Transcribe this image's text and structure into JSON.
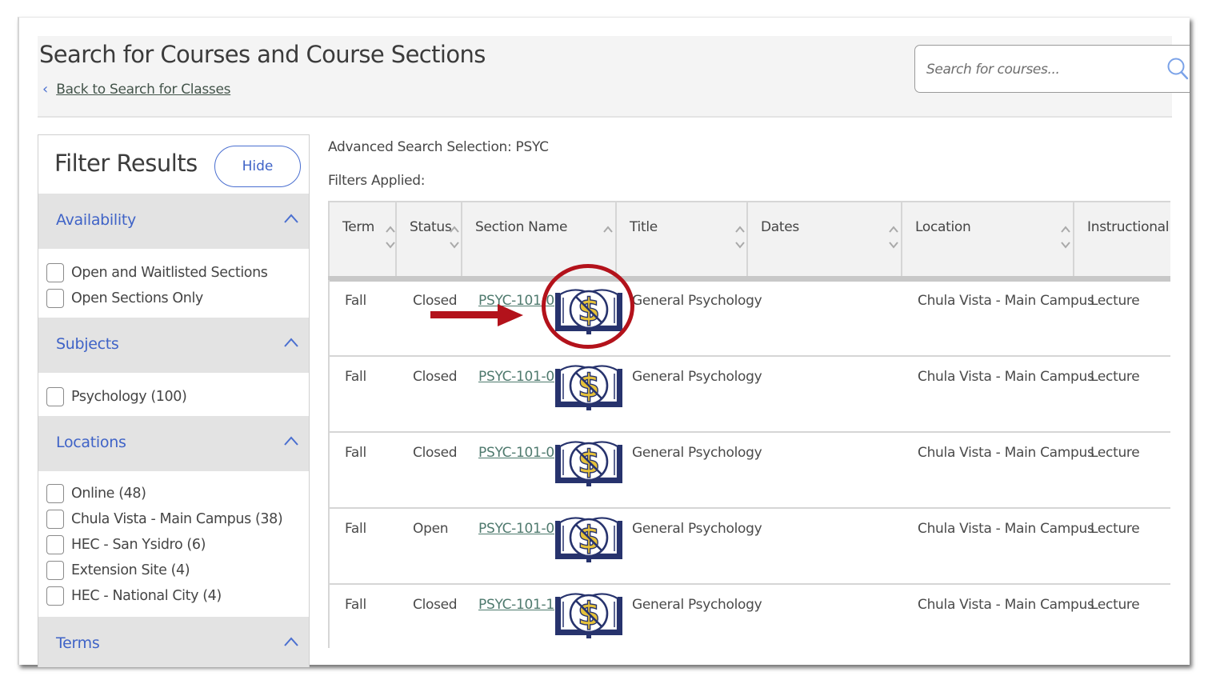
{
  "header": {
    "title": "Search for Courses and Course Sections",
    "back_link": "Back to Search for Classes",
    "search_placeholder": "Search for courses..."
  },
  "filters": {
    "title": "Filter Results",
    "hide_label": "Hide",
    "sections": [
      {
        "label": "Availability",
        "options": [
          "Open and Waitlisted Sections",
          "Open Sections Only"
        ]
      },
      {
        "label": "Subjects",
        "options": [
          "Psychology (100)"
        ]
      },
      {
        "label": "Locations",
        "options": [
          "Online (48)",
          "Chula Vista - Main Campus (38)",
          "HEC - San Ysidro (6)",
          "Extension Site (4)",
          "HEC - National City (4)"
        ]
      },
      {
        "label": "Terms",
        "options": []
      }
    ]
  },
  "main": {
    "advanced_search": "Advanced Search Selection: PSYC",
    "filters_applied": "Filters Applied:"
  },
  "table": {
    "columns": [
      "Term",
      "Status",
      "Section Name",
      "Title",
      "Dates",
      "Location",
      "Instructional M"
    ],
    "rows": [
      {
        "term": "Fall",
        "status": "Closed",
        "section": "PSYC-101-01",
        "title": "General Psychology",
        "dates": "",
        "location": "Chula Vista - Main Campus",
        "method": "Lecture",
        "icon": "zero-textbook-cost-icon"
      },
      {
        "term": "Fall",
        "status": "Closed",
        "section": "PSYC-101-02",
        "title": "General Psychology",
        "dates": "",
        "location": "Chula Vista - Main Campus",
        "method": "Lecture",
        "icon": "zero-textbook-cost-icon"
      },
      {
        "term": "Fall",
        "status": "Closed",
        "section": "PSYC-101-03",
        "title": "General Psychology",
        "dates": "",
        "location": "Chula Vista - Main Campus",
        "method": "Lecture",
        "icon": "zero-textbook-cost-icon"
      },
      {
        "term": "Fall",
        "status": "Open",
        "section": "PSYC-101-04",
        "title": "General Psychology",
        "dates": "",
        "location": "Chula Vista - Main Campus",
        "method": "Lecture",
        "icon": "zero-textbook-cost-icon"
      },
      {
        "term": "Fall",
        "status": "Closed",
        "section": "PSYC-101-15",
        "title": "General Psychology",
        "dates": "",
        "location": "Chula Vista - Main Campus",
        "method": "Lecture",
        "icon": "zero-textbook-cost-icon"
      }
    ]
  },
  "colors": {
    "accent_blue": "#3f63c7",
    "link_green": "#4f7a6e",
    "annotation_red": "#b3121b",
    "icon_navy": "#27336d",
    "icon_gold": "#e6c23a"
  }
}
